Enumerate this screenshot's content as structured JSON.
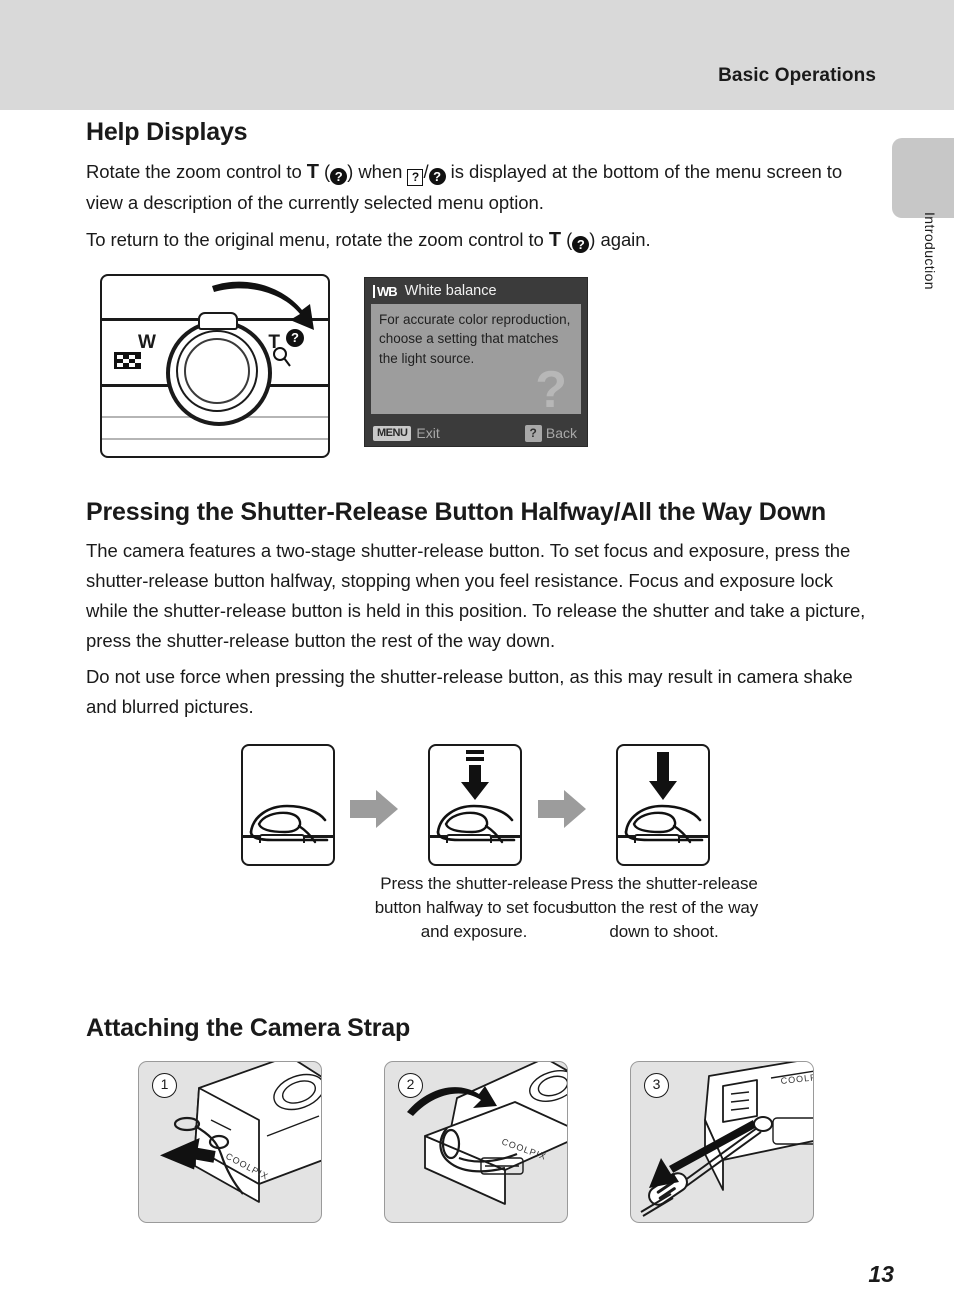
{
  "header": {
    "running_title": "Basic Operations"
  },
  "side_tab": {
    "label": "Introduction"
  },
  "sections": {
    "help_displays": {
      "title": "Help Displays",
      "para1_a": "Rotate the zoom control to ",
      "para1_T": "T",
      "para1_b": " (",
      "para1_help_icon": "?",
      "para1_c": ") when ",
      "para1_boxicon": "?",
      "para1_slash": "/",
      "para1_help_icon2": "?",
      "para1_d": " is displayed at the bottom of the menu screen to view a description of the currently selected menu option.",
      "para2_a": "To return to the original menu, rotate the zoom control to ",
      "para2_T": "T",
      "para2_b": " (",
      "para2_help_icon": "?",
      "para2_c": ") again."
    },
    "shutter": {
      "title": "Pressing the Shutter-Release Button Halfway/All the Way Down",
      "para1": "The camera features a two-stage shutter-release button. To set focus and exposure, press the shutter-release button halfway, stopping when you feel resistance. Focus and exposure lock while the shutter-release button is held in this position. To release the shutter and take a picture, press the shutter-release button the rest of the way down.",
      "para2": "Do not use force when pressing the shutter-release button, as this may result in camera shake and blurred pictures.",
      "caption2": "Press the shutter-release button halfway to set focus and exposure.",
      "caption3": "Press the shutter-release button the rest of the way down to shoot."
    },
    "strap": {
      "title": "Attaching the Camera Strap",
      "steps": [
        {
          "number": "1",
          "brand": "COOLPIX"
        },
        {
          "number": "2",
          "brand": "COOLPIX"
        },
        {
          "number": "3",
          "brand": "COOLPIX"
        }
      ]
    }
  },
  "zoom_control": {
    "wide_label": "W",
    "tele_label": "T",
    "help_glyph": "?"
  },
  "lcd": {
    "wb_icon": "WB",
    "title": "White balance",
    "body": "For accurate color reproduction, choose a setting that matches the light source.",
    "watermark": "?",
    "menu_chip": "MENU",
    "exit_label": "Exit",
    "back_chip": "?",
    "back_label": "Back"
  },
  "footer": {
    "page_number": "13"
  },
  "colors": {
    "header_band": "#d9d9d9",
    "side_tab": "#c7c7c7",
    "lcd_frame": "#3b3b3b",
    "lcd_body": "#9d9d9d",
    "panel_bg": "#e3e3e3",
    "seq_arrow": "#9c9c9c"
  }
}
